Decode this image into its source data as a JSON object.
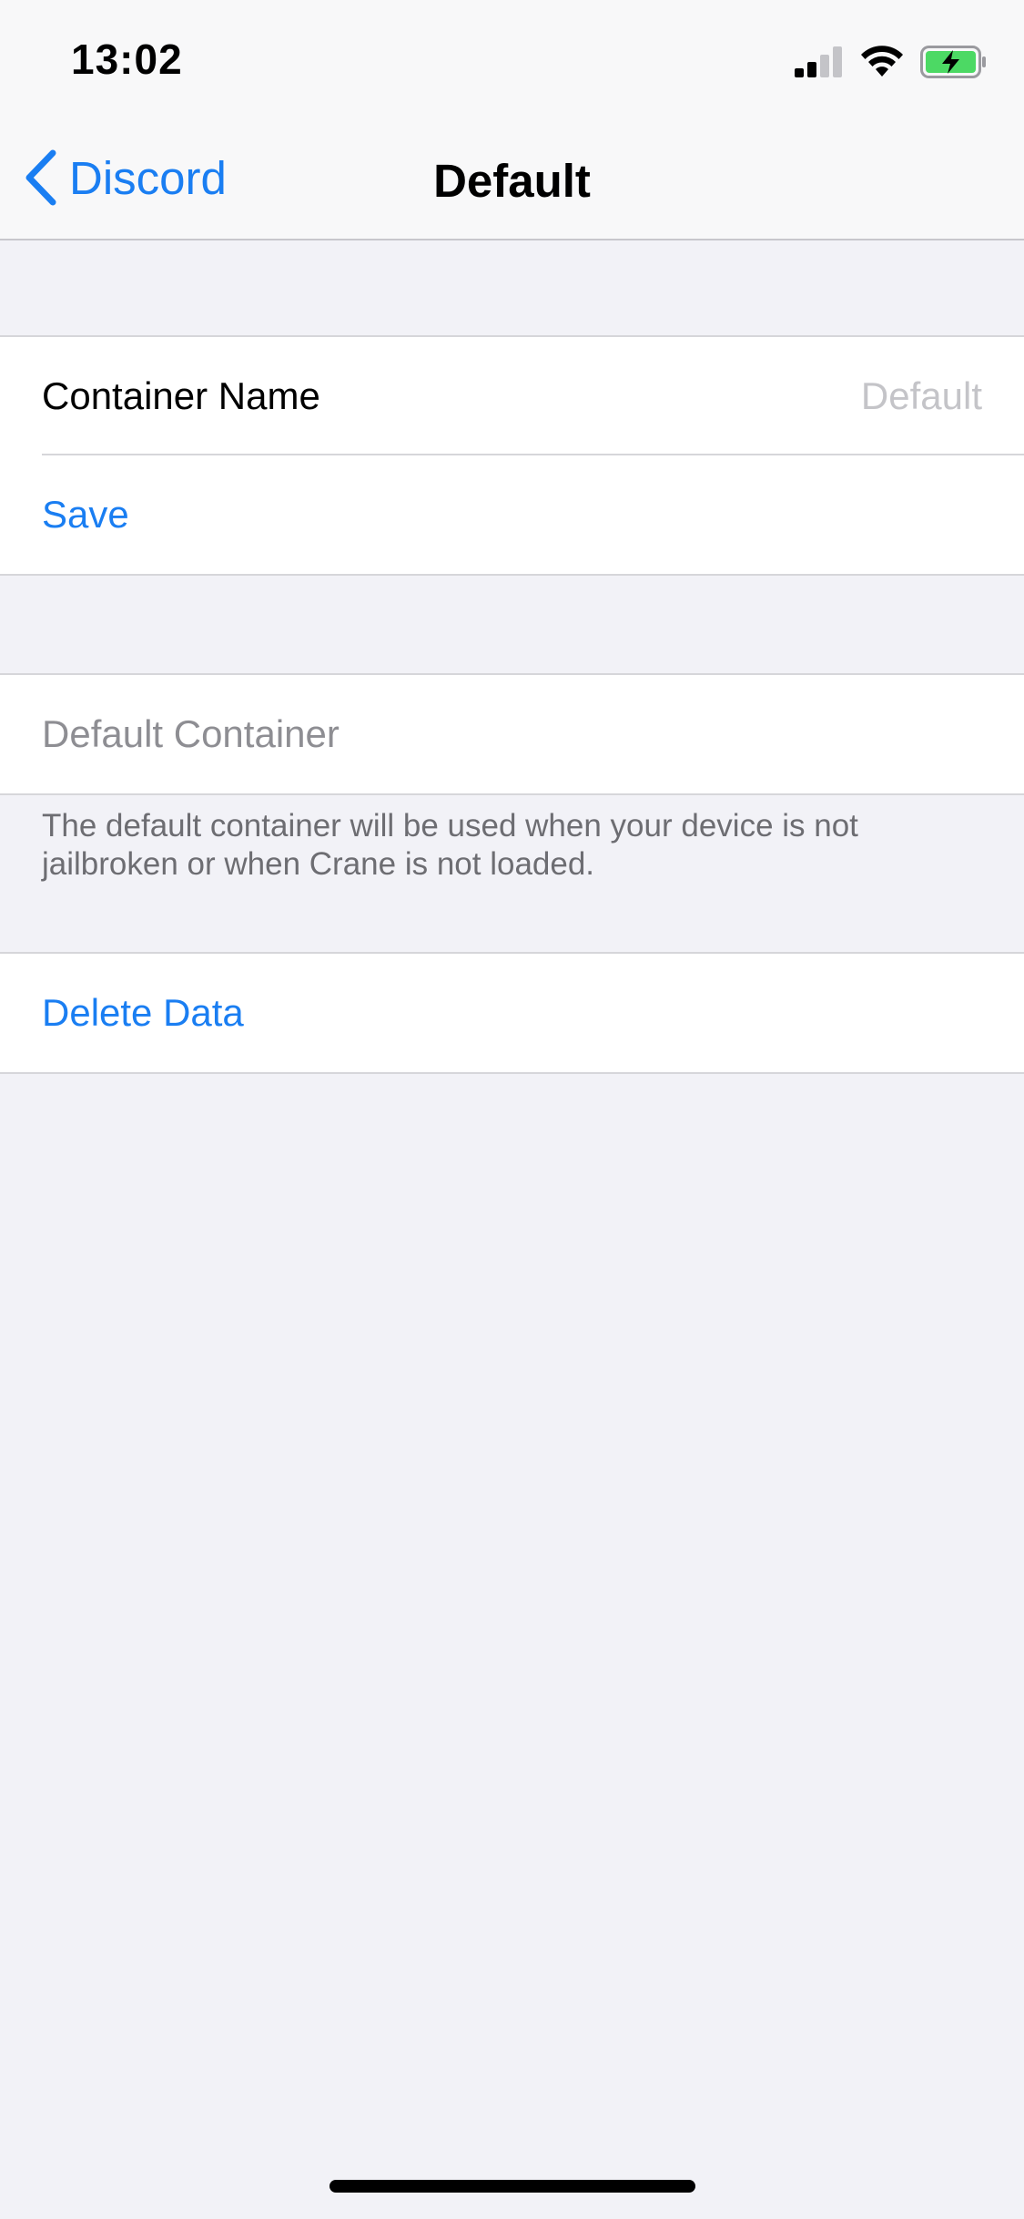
{
  "status_bar": {
    "time": "13:02",
    "icons": [
      "signal-icon",
      "wifi-icon",
      "battery-charging-icon"
    ]
  },
  "nav": {
    "back_label": "Discord",
    "title": "Default"
  },
  "container_section": {
    "name_label": "Container Name",
    "name_placeholder": "Default",
    "save_label": "Save"
  },
  "default_section": {
    "default_container_label": "Default Container",
    "footer": "The default container will be used when your device is not jailbroken or when Crane is not loaded."
  },
  "data_section": {
    "delete_label": "Delete Data"
  },
  "colors": {
    "accent": "#1a7ef2",
    "background": "#f2f2f7",
    "battery_green": "#4cd964"
  }
}
